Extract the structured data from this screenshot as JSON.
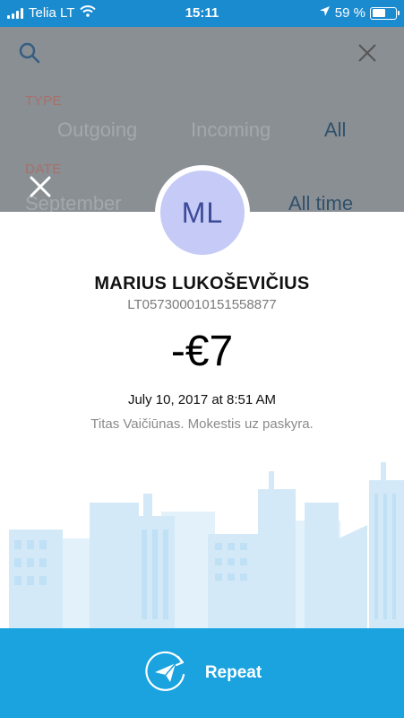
{
  "status_bar": {
    "carrier": "Telia LT",
    "time": "15:11",
    "battery": "59 %",
    "battery_level": 0.59
  },
  "filters": {
    "type_label": "TYPE",
    "type_options": [
      "Outgoing",
      "Incoming",
      "All"
    ],
    "type_selected": "All",
    "date_label": "DATE",
    "date_options": [
      "September",
      "All time"
    ],
    "date_selected": "All time"
  },
  "transaction": {
    "avatar_initials": "ML",
    "name": "MARIUS LUKOŠEVIČIUS",
    "iban": "LT057300010151558877",
    "amount": "-€7",
    "date": "July 10, 2017 at 8:51 AM",
    "description": "Titas Vaičiūnas. Mokestis uz paskyra."
  },
  "actions": {
    "repeat_label": "Repeat"
  },
  "colors": {
    "status_bar": "#1b8bd0",
    "repeat_bar": "#1aa3df",
    "avatar_bg": "#c5cbf6",
    "avatar_text": "#3e4a99",
    "city": "#d6ecf9"
  }
}
